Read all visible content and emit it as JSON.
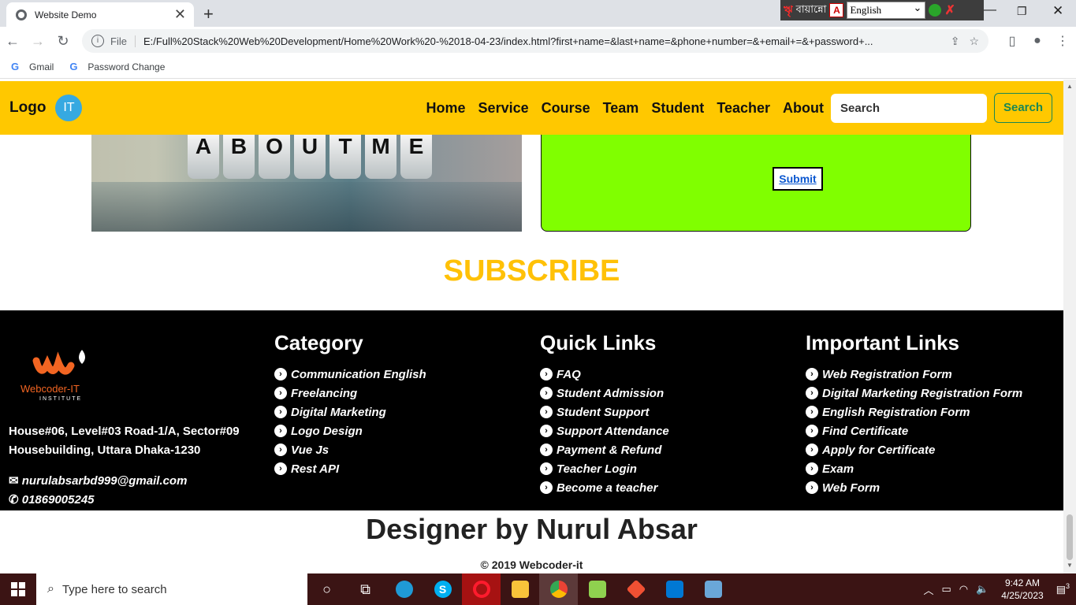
{
  "browser": {
    "tab_title": "Website Demo",
    "url_scheme": "File",
    "url": "E:/Full%20Stack%20Web%20Development/Home%20Work%20-%2018-04-23/index.html?first+name=&last+name=&phone+number=&+email+=&+password+...",
    "bookmarks": [
      {
        "label": "Gmail",
        "icon": "google-icon"
      },
      {
        "label": "Password Change",
        "icon": "google-icon"
      }
    ]
  },
  "langbar": {
    "bangla_label": "বায়ান্নো",
    "selected_language": "English"
  },
  "navbar": {
    "logo_text": "Logo",
    "logo_badge": "IT",
    "menu": [
      "Home",
      "Service",
      "Course",
      "Team",
      "Student",
      "Teacher",
      "About"
    ],
    "search_placeholder": "Search",
    "search_button": "Search"
  },
  "about": {
    "image_letters": [
      "A",
      "B",
      "O",
      "U",
      "T",
      "M",
      "E"
    ],
    "submit_label": "Submit"
  },
  "subscribe_heading": "SUBSCRIBE",
  "footer": {
    "brand": "Webcoder-IT",
    "brand_sub": "INSTITUTE",
    "address_line1": "House#06, Level#03 Road-1/A, Sector#09",
    "address_line2": "Housebuilding, Uttara Dhaka-1230",
    "email": "nurulabsarbd999@gmail.com",
    "phone": "01869005245",
    "category": {
      "heading": "Category",
      "items": [
        "Communication English",
        "Freelancing",
        "Digital Marketing",
        "Logo Design",
        "Vue Js",
        "Rest API"
      ]
    },
    "quick_links": {
      "heading": "Quick Links",
      "items": [
        "FAQ",
        "Student Admission",
        "Student Support",
        "Support Attendance",
        "Payment & Refund",
        "Teacher Login",
        "Become a teacher"
      ]
    },
    "important_links": {
      "heading": "Important Links",
      "items": [
        "Web Registration Form",
        "Digital Marketing Registration Form",
        "English Registration Form",
        "Find Certificate",
        "Apply for Certificate",
        "Exam",
        "Web Form"
      ]
    }
  },
  "designer": "Designer by Nurul Absar",
  "copyright": "© 2019 Webcoder-it",
  "taskbar": {
    "search_placeholder": "Type here to search",
    "time": "9:42 AM",
    "date": "4/25/2023",
    "notification_count": "3"
  },
  "colors": {
    "navbar": "#ffc800",
    "subscribe": "#ffc107",
    "form_bg": "#80ff00",
    "footer": "#000000",
    "taskbar": "#3b1414"
  }
}
